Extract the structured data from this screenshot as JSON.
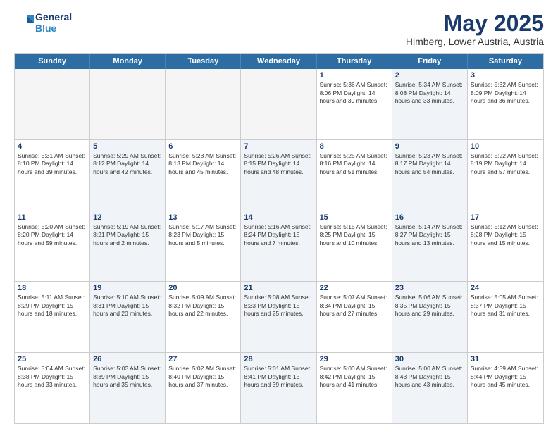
{
  "header": {
    "logo_line1": "General",
    "logo_line2": "Blue",
    "month": "May 2025",
    "location": "Himberg, Lower Austria, Austria"
  },
  "days": [
    "Sunday",
    "Monday",
    "Tuesday",
    "Wednesday",
    "Thursday",
    "Friday",
    "Saturday"
  ],
  "rows": [
    [
      {
        "day": "",
        "content": "",
        "shaded": false,
        "empty": true
      },
      {
        "day": "",
        "content": "",
        "shaded": false,
        "empty": true
      },
      {
        "day": "",
        "content": "",
        "shaded": false,
        "empty": true
      },
      {
        "day": "",
        "content": "",
        "shaded": false,
        "empty": true
      },
      {
        "day": "1",
        "content": "Sunrise: 5:36 AM\nSunset: 8:06 PM\nDaylight: 14 hours\nand 30 minutes.",
        "shaded": false,
        "empty": false
      },
      {
        "day": "2",
        "content": "Sunrise: 5:34 AM\nSunset: 8:08 PM\nDaylight: 14 hours\nand 33 minutes.",
        "shaded": true,
        "empty": false
      },
      {
        "day": "3",
        "content": "Sunrise: 5:32 AM\nSunset: 8:09 PM\nDaylight: 14 hours\nand 36 minutes.",
        "shaded": false,
        "empty": false
      }
    ],
    [
      {
        "day": "4",
        "content": "Sunrise: 5:31 AM\nSunset: 8:10 PM\nDaylight: 14 hours\nand 39 minutes.",
        "shaded": false,
        "empty": false
      },
      {
        "day": "5",
        "content": "Sunrise: 5:29 AM\nSunset: 8:12 PM\nDaylight: 14 hours\nand 42 minutes.",
        "shaded": true,
        "empty": false
      },
      {
        "day": "6",
        "content": "Sunrise: 5:28 AM\nSunset: 8:13 PM\nDaylight: 14 hours\nand 45 minutes.",
        "shaded": false,
        "empty": false
      },
      {
        "day": "7",
        "content": "Sunrise: 5:26 AM\nSunset: 8:15 PM\nDaylight: 14 hours\nand 48 minutes.",
        "shaded": true,
        "empty": false
      },
      {
        "day": "8",
        "content": "Sunrise: 5:25 AM\nSunset: 8:16 PM\nDaylight: 14 hours\nand 51 minutes.",
        "shaded": false,
        "empty": false
      },
      {
        "day": "9",
        "content": "Sunrise: 5:23 AM\nSunset: 8:17 PM\nDaylight: 14 hours\nand 54 minutes.",
        "shaded": true,
        "empty": false
      },
      {
        "day": "10",
        "content": "Sunrise: 5:22 AM\nSunset: 8:19 PM\nDaylight: 14 hours\nand 57 minutes.",
        "shaded": false,
        "empty": false
      }
    ],
    [
      {
        "day": "11",
        "content": "Sunrise: 5:20 AM\nSunset: 8:20 PM\nDaylight: 14 hours\nand 59 minutes.",
        "shaded": false,
        "empty": false
      },
      {
        "day": "12",
        "content": "Sunrise: 5:19 AM\nSunset: 8:21 PM\nDaylight: 15 hours\nand 2 minutes.",
        "shaded": true,
        "empty": false
      },
      {
        "day": "13",
        "content": "Sunrise: 5:17 AM\nSunset: 8:23 PM\nDaylight: 15 hours\nand 5 minutes.",
        "shaded": false,
        "empty": false
      },
      {
        "day": "14",
        "content": "Sunrise: 5:16 AM\nSunset: 8:24 PM\nDaylight: 15 hours\nand 7 minutes.",
        "shaded": true,
        "empty": false
      },
      {
        "day": "15",
        "content": "Sunrise: 5:15 AM\nSunset: 8:25 PM\nDaylight: 15 hours\nand 10 minutes.",
        "shaded": false,
        "empty": false
      },
      {
        "day": "16",
        "content": "Sunrise: 5:14 AM\nSunset: 8:27 PM\nDaylight: 15 hours\nand 13 minutes.",
        "shaded": true,
        "empty": false
      },
      {
        "day": "17",
        "content": "Sunrise: 5:12 AM\nSunset: 8:28 PM\nDaylight: 15 hours\nand 15 minutes.",
        "shaded": false,
        "empty": false
      }
    ],
    [
      {
        "day": "18",
        "content": "Sunrise: 5:11 AM\nSunset: 8:29 PM\nDaylight: 15 hours\nand 18 minutes.",
        "shaded": false,
        "empty": false
      },
      {
        "day": "19",
        "content": "Sunrise: 5:10 AM\nSunset: 8:31 PM\nDaylight: 15 hours\nand 20 minutes.",
        "shaded": true,
        "empty": false
      },
      {
        "day": "20",
        "content": "Sunrise: 5:09 AM\nSunset: 8:32 PM\nDaylight: 15 hours\nand 22 minutes.",
        "shaded": false,
        "empty": false
      },
      {
        "day": "21",
        "content": "Sunrise: 5:08 AM\nSunset: 8:33 PM\nDaylight: 15 hours\nand 25 minutes.",
        "shaded": true,
        "empty": false
      },
      {
        "day": "22",
        "content": "Sunrise: 5:07 AM\nSunset: 8:34 PM\nDaylight: 15 hours\nand 27 minutes.",
        "shaded": false,
        "empty": false
      },
      {
        "day": "23",
        "content": "Sunrise: 5:06 AM\nSunset: 8:35 PM\nDaylight: 15 hours\nand 29 minutes.",
        "shaded": true,
        "empty": false
      },
      {
        "day": "24",
        "content": "Sunrise: 5:05 AM\nSunset: 8:37 PM\nDaylight: 15 hours\nand 31 minutes.",
        "shaded": false,
        "empty": false
      }
    ],
    [
      {
        "day": "25",
        "content": "Sunrise: 5:04 AM\nSunset: 8:38 PM\nDaylight: 15 hours\nand 33 minutes.",
        "shaded": false,
        "empty": false
      },
      {
        "day": "26",
        "content": "Sunrise: 5:03 AM\nSunset: 8:39 PM\nDaylight: 15 hours\nand 35 minutes.",
        "shaded": true,
        "empty": false
      },
      {
        "day": "27",
        "content": "Sunrise: 5:02 AM\nSunset: 8:40 PM\nDaylight: 15 hours\nand 37 minutes.",
        "shaded": false,
        "empty": false
      },
      {
        "day": "28",
        "content": "Sunrise: 5:01 AM\nSunset: 8:41 PM\nDaylight: 15 hours\nand 39 minutes.",
        "shaded": true,
        "empty": false
      },
      {
        "day": "29",
        "content": "Sunrise: 5:00 AM\nSunset: 8:42 PM\nDaylight: 15 hours\nand 41 minutes.",
        "shaded": false,
        "empty": false
      },
      {
        "day": "30",
        "content": "Sunrise: 5:00 AM\nSunset: 8:43 PM\nDaylight: 15 hours\nand 43 minutes.",
        "shaded": true,
        "empty": false
      },
      {
        "day": "31",
        "content": "Sunrise: 4:59 AM\nSunset: 8:44 PM\nDaylight: 15 hours\nand 45 minutes.",
        "shaded": false,
        "empty": false
      }
    ]
  ]
}
